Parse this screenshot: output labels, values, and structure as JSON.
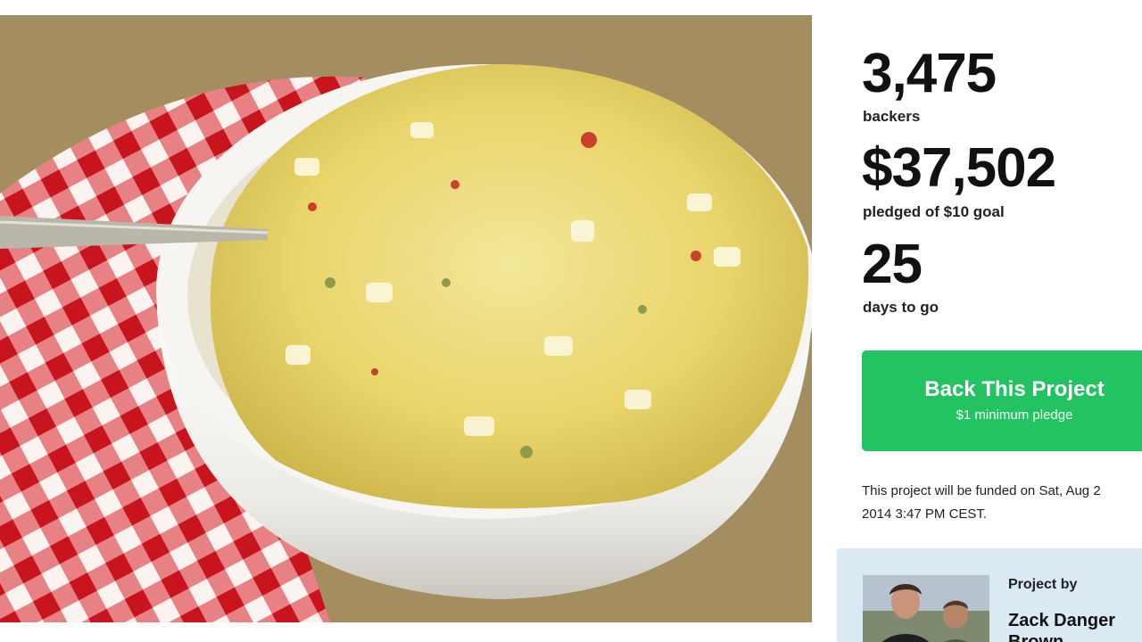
{
  "stats": {
    "backers_count": "3,475",
    "backers_label": "backers",
    "pledged_amount": "$37,502",
    "pledged_label": "pledged of $10 goal",
    "days_count": "25",
    "days_label": "days to go"
  },
  "back_button": {
    "title": "Back This Project",
    "subtitle": "$1 minimum pledge"
  },
  "funding_note": "This project will be funded on Sat, Aug 2 2014 3:47 PM CEST.",
  "creator": {
    "project_by_label": "Project by",
    "name": "Zack Danger Brown"
  },
  "colors": {
    "back_button": "#22c360",
    "creator_card": "#dbe9f3",
    "tablecloth_red": "#d8232a"
  }
}
